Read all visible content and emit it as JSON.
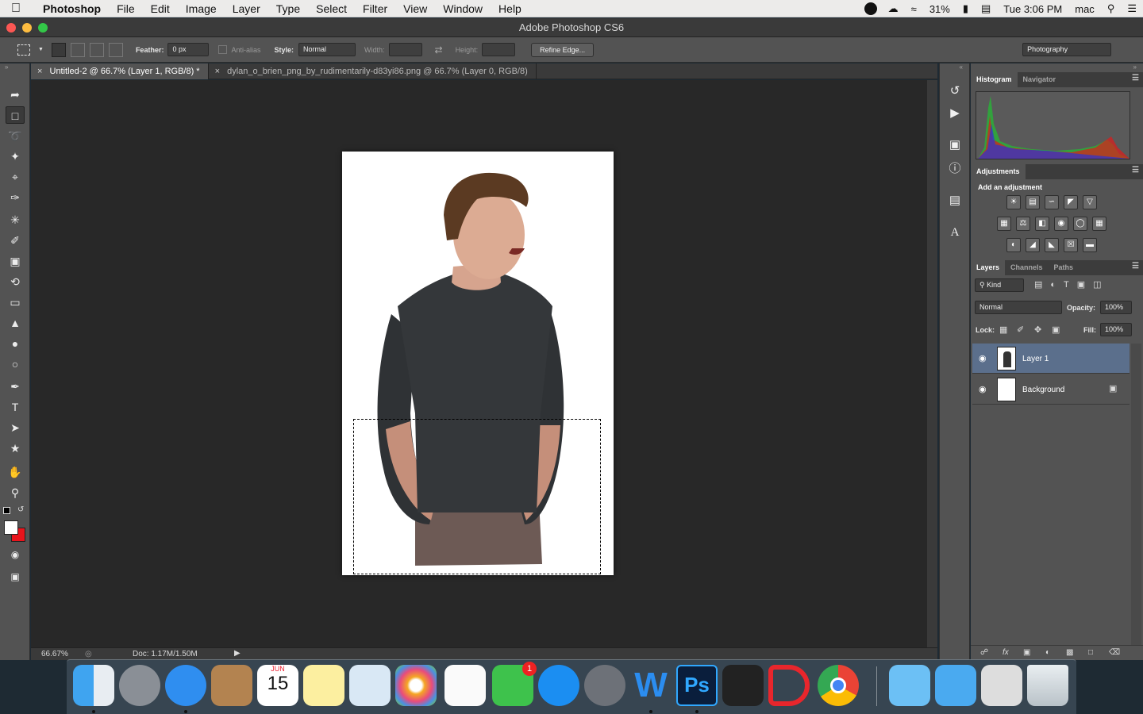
{
  "menubar": {
    "app_name": "Photoshop",
    "menus": [
      "File",
      "Edit",
      "Image",
      "Layer",
      "Type",
      "Select",
      "Filter",
      "View",
      "Window",
      "Help"
    ],
    "battery": "31%",
    "clock": "Tue 3:06 PM",
    "user": "mac"
  },
  "window": {
    "title": "Adobe Photoshop CS6"
  },
  "options": {
    "feather_label": "Feather:",
    "feather_value": "0 px",
    "antialias_label": "Anti-alias",
    "style_label": "Style:",
    "style_value": "Normal",
    "width_label": "Width:",
    "height_label": "Height:",
    "refine_edge": "Refine Edge...",
    "workspace": "Photography"
  },
  "tabs": [
    {
      "label": "Untitled-2 @ 66.7% (Layer 1, RGB/8) *"
    },
    {
      "label": "dylan_o_brien_png_by_rudimentarily-d83yi86.png @ 66.7% (Layer 0, RGB/8)"
    }
  ],
  "status": {
    "zoom": "66.67%",
    "doc": "Doc: 1.17M/1.50M"
  },
  "panels": {
    "histogram_tab": "Histogram",
    "navigator_tab": "Navigator",
    "adjustments_tab": "Adjustments",
    "add_adjustment": "Add an adjustment",
    "layers_tab": "Layers",
    "channels_tab": "Channels",
    "paths_tab": "Paths",
    "kind": "Kind",
    "blend_mode": "Normal",
    "opacity_label": "Opacity:",
    "opacity_value": "100%",
    "lock_label": "Lock:",
    "fill_label": "Fill:",
    "fill_value": "100%",
    "layers": [
      {
        "name": "Layer 1"
      },
      {
        "name": "Background"
      }
    ]
  },
  "dock": {
    "calendar_month": "JUN",
    "calendar_day": "15",
    "facetime_badge": "1",
    "ps_label": "Ps",
    "word_label": "W"
  },
  "colors": {
    "accent_selected_layer": "#5b6f8c",
    "background_color_swatch": "#e8141c",
    "foreground_color_swatch": "#ffffff"
  }
}
